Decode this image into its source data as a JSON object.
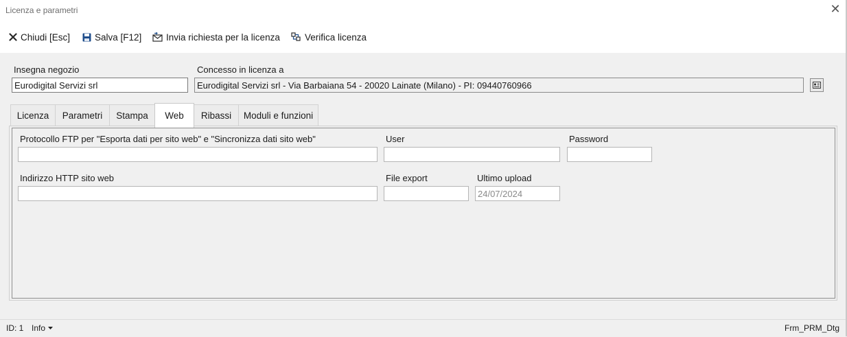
{
  "window": {
    "title": "Licenza e parametri",
    "close_glyph": "✕"
  },
  "toolbar": {
    "close_label": "Chiudi [Esc]",
    "save_label": "Salva [F12]",
    "send_request_label": "Invia richiesta per la licenza",
    "verify_label": "Verifica licenza"
  },
  "header": {
    "shop_sign_label": "Insegna negozio",
    "shop_sign_value": "Eurodigital Servizi srl",
    "licensed_to_label": "Concesso in licenza a",
    "licensed_to_value": "Eurodigital Servizi srl - Via Barbaiana 54 - 20020 Lainate (Milano) - PI: 09440760966"
  },
  "tabs": [
    {
      "label": "Licenza",
      "active": false
    },
    {
      "label": "Parametri",
      "active": false
    },
    {
      "label": "Stampa",
      "active": false
    },
    {
      "label": "Web",
      "active": true
    },
    {
      "label": "Ribassi",
      "active": false
    },
    {
      "label": "Moduli e funzioni",
      "active": false
    }
  ],
  "web": {
    "ftp_label": "Protocollo FTP per \"Esporta dati per sito web\" e \"Sincronizza dati sito web\"",
    "ftp_value": "",
    "user_label": "User",
    "user_value": "",
    "password_label": "Password",
    "password_value": "",
    "http_label": "Indirizzo HTTP sito web",
    "http_value": "",
    "file_export_label": "File export",
    "file_export_value": "",
    "last_upload_label": "Ultimo upload",
    "last_upload_value": "24/07/2024"
  },
  "status": {
    "id_text": "ID: 1",
    "info_label": "Info",
    "form_name": "Frm_PRM_Dtg"
  },
  "colors": {
    "background": "#f0f0f0",
    "toolbar_bg": "#ffffff",
    "save_icon": "#1f4e8c"
  }
}
